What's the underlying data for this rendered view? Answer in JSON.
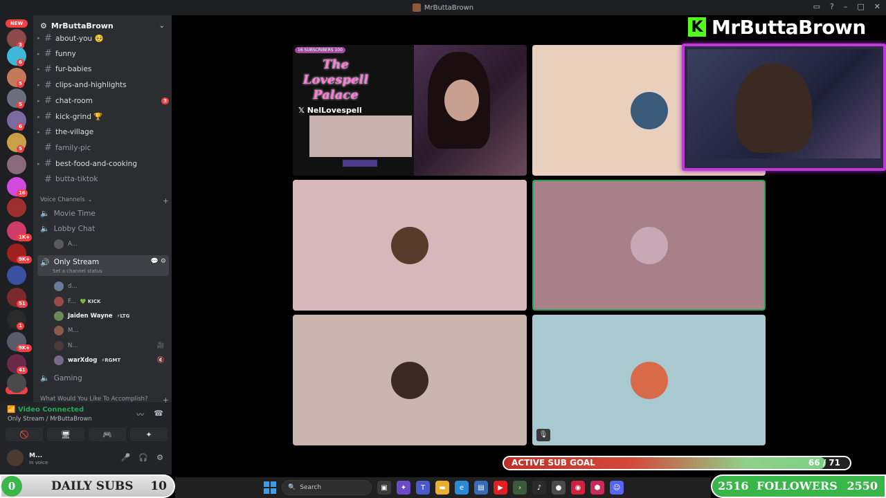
{
  "window": {
    "title": "MrButtaBrown"
  },
  "server": {
    "name": "MrButtaBrown"
  },
  "server_rail": [
    {
      "badge": "3",
      "color": "#8b4a4a"
    },
    {
      "badge": "6",
      "color": "#3fb7d6"
    },
    {
      "badge": "5",
      "color": "#c47a5a"
    },
    {
      "badge": "5",
      "color": "#6a7080"
    },
    {
      "badge": "6",
      "color": "#7a6aa0"
    },
    {
      "badge": "5",
      "color": "#c8a048"
    },
    {
      "badge": "",
      "color": "#8a6a7a"
    },
    {
      "badge": "16",
      "color": "#d04ae0"
    },
    {
      "badge": "",
      "color": "#a03030"
    },
    {
      "badge": "1K+",
      "color": "#d03a6a"
    },
    {
      "badge": "9K+",
      "color": "#a02020"
    },
    {
      "badge": "",
      "color": "#3a50a0"
    },
    {
      "badge": "51",
      "color": "#7a2a2a"
    },
    {
      "badge": "1",
      "color": "#2a2a2a"
    },
    {
      "badge": "9K+",
      "color": "#5a5a6a"
    },
    {
      "badge": "41",
      "color": "#6a2a4a"
    },
    {
      "badge": "",
      "color": "#4a4a4a"
    }
  ],
  "new_label": "NEW",
  "text_channels": [
    {
      "name": "about-you 🥺",
      "arrow": true,
      "muted": false
    },
    {
      "name": "funny",
      "arrow": true,
      "muted": false
    },
    {
      "name": "fur-babies",
      "arrow": true,
      "muted": false
    },
    {
      "name": "clips-and-highlights",
      "arrow": true,
      "muted": false
    },
    {
      "name": "chat-room",
      "arrow": true,
      "muted": false,
      "count": "3"
    },
    {
      "name": "kick-grind 🏆",
      "arrow": true,
      "muted": false
    },
    {
      "name": "the-village",
      "arrow": true,
      "muted": false
    },
    {
      "name": "family-pic",
      "arrow": false,
      "muted": true
    },
    {
      "name": "best-food-and-cooking",
      "arrow": true,
      "muted": false
    },
    {
      "name": "butta-tiktok",
      "arrow": false,
      "muted": true
    }
  ],
  "voice_category": "Voice Channels",
  "voice_channels": {
    "movie": "Movie Time",
    "lobby": "Lobby Chat",
    "lobby_user": "A...",
    "only_stream": "Only Stream",
    "only_stream_status": "Set a channel status",
    "gaming": "Gaming",
    "next_category": "What Would You Like To Accomplish?"
  },
  "stream_users": [
    {
      "name": "d...",
      "tag": "",
      "bright": false,
      "color": "#6a7a9a"
    },
    {
      "name": "F...",
      "tag": "💚 KICK",
      "bright": false,
      "color": "#9a4a4a"
    },
    {
      "name": "Jaiden Wayne",
      "tag": "⚡LTG",
      "bright": true,
      "color": "#6a8a5a"
    },
    {
      "name": "M...",
      "tag": "",
      "bright": false,
      "color": "#8a5a4a"
    },
    {
      "name": "N...",
      "tag": "",
      "bright": false,
      "color": "#4a3a3a",
      "right": "🎥"
    },
    {
      "name": "warXdog",
      "tag": "⚡RGMT",
      "bright": true,
      "color": "#7a6a8a",
      "right": "🔇"
    }
  ],
  "voice_panel": {
    "status": "Video Connected",
    "location": "Only Stream / MrButtaBrown"
  },
  "user_panel": {
    "name": "M...",
    "status": "In voice"
  },
  "tiles": [
    {
      "bg": "#e9d0bd"
    },
    {
      "bg": "#d8b7bb"
    },
    {
      "bg": "#a88089"
    },
    {
      "bg": "#c9b5ad"
    },
    {
      "bg": "#a9c9d1"
    }
  ],
  "screenshare": {
    "overlay_badge": "16 SUBSCRIBERS 100",
    "title": "The Lovespell Palace",
    "handle": "NelLovespell"
  },
  "logo_text": "MrButtaBrown",
  "sub_goal": {
    "label": "ACTIVE SUB GOAL",
    "current": 66,
    "target": 71,
    "display": "66 / 71"
  },
  "daily_subs": {
    "count": "0",
    "label": "DAILY SUBS",
    "goal": "10"
  },
  "followers": {
    "current": "2516",
    "label": "FOLLOWERS",
    "goal": "2550"
  },
  "taskbar": {
    "search_placeholder": "Search"
  }
}
